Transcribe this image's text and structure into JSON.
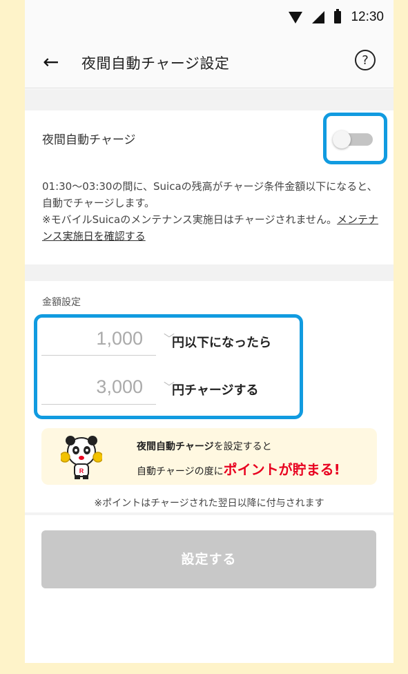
{
  "status": {
    "time": "12:30"
  },
  "appbar": {
    "title": "夜間自動チャージ設定",
    "back_icon": "←",
    "help_icon": "?"
  },
  "auto_charge": {
    "label": "夜間自動チャージ",
    "enabled": false,
    "description_main": "01:30〜03:30の間に、Suicaの残高がチャージ条件金額以下になると、自動でチャージします。",
    "description_note": "※モバイルSuicaのメンテナンス実施日はチャージされません。",
    "maintenance_link": "メンテナンス実施日を確認する"
  },
  "amount": {
    "section_label": "金額設定",
    "threshold_value": "1,000",
    "threshold_suffix": "円以下になったら",
    "charge_value": "3,000",
    "charge_suffix": "円チャージする"
  },
  "promo": {
    "line1_bold": "夜間自動チャージ",
    "line1_rest": "を設定すると",
    "line2_prefix": "自動チャージの度に",
    "line2_highlight": "ポイントが貯まる!"
  },
  "note": "※ポイントはチャージされた翌日以降に付与されます",
  "submit_label": "設定する",
  "colors": {
    "highlight": "#119be0",
    "promo_red": "#e8001f",
    "promo_bg": "#fff8e1",
    "page_bg": "#fef3c9"
  }
}
